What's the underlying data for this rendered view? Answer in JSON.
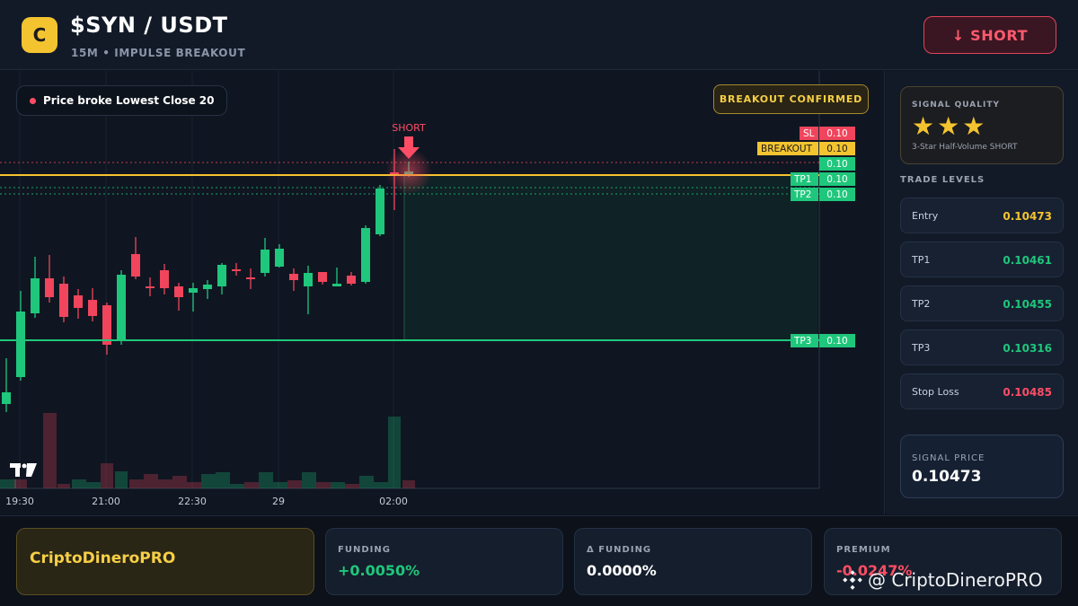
{
  "header": {
    "logo_letter": "C",
    "pair": "$SYN / USDT",
    "subtitle": "15M • IMPULSE BREAKOUT",
    "short_button": "↓ SHORT"
  },
  "chart": {
    "chip_text": "Price broke Lowest Close 20",
    "confirmed_badge": "BREAKOUT CONFIRMED",
    "short_marker_label": "SHORT",
    "tv_logo": "TV",
    "time_labels": [
      "19:30",
      "21:00",
      "22:30",
      "29",
      "02:00"
    ],
    "price_tags": [
      {
        "name": "SL",
        "value": "0.10",
        "color": "#f0455c"
      },
      {
        "name": "BREAKOUT",
        "value": "0.10",
        "color": "#f4c430"
      },
      {
        "name": "",
        "value": "0.10",
        "color": "#1fc77c"
      },
      {
        "name": "TP1",
        "value": "0.10",
        "color": "#1fc77c"
      },
      {
        "name": "TP2",
        "value": "0.10",
        "color": "#1fc77c"
      },
      {
        "name": "TP3",
        "value": "0.10",
        "color": "#1fc77c"
      }
    ]
  },
  "side": {
    "quality_label": "SIGNAL QUALITY",
    "stars": "★★★",
    "star_count": 3,
    "quality_desc": "3-Star Half-Volume SHORT",
    "trade_levels_title": "TRADE LEVELS",
    "levels": [
      {
        "name": "Entry",
        "value": "0.10473",
        "color": "#f4c430"
      },
      {
        "name": "TP1",
        "value": "0.10461",
        "color": "#1fc77c"
      },
      {
        "name": "TP2",
        "value": "0.10455",
        "color": "#1fc77c"
      },
      {
        "name": "TP3",
        "value": "0.10316",
        "color": "#1fc77c"
      },
      {
        "name": "Stop Loss",
        "value": "0.10485",
        "color": "#ff4d65"
      }
    ],
    "signal_price_label": "SIGNAL PRICE",
    "signal_price": "0.10473"
  },
  "bottom": {
    "brand": "CriptoDineroPRO",
    "stats": [
      {
        "label": "FUNDING",
        "value": "+0.0050%",
        "color": "#1fc77c"
      },
      {
        "label": "Δ FUNDING",
        "value": "0.0000%",
        "color": "#ffffff"
      },
      {
        "label": "PREMIUM",
        "value": "-0.0247%",
        "color": "#ff4d65"
      }
    ],
    "watermark": "@ CriptoDineroPRO"
  },
  "colors": {
    "bull": "#1fc77c",
    "bear": "#f0455c",
    "accent": "#f4c430"
  }
}
